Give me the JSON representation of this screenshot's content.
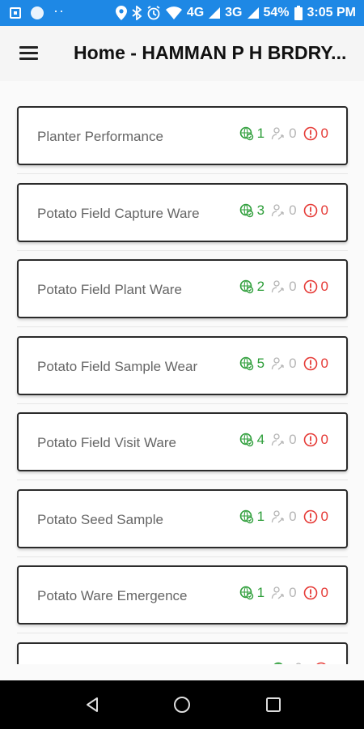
{
  "status_bar": {
    "network": "4G",
    "network2": "3G",
    "battery": "54%",
    "time": "3:05 PM",
    "background": "#1e88e5"
  },
  "header": {
    "title": "Home - HAMMAN P H BRDRY..."
  },
  "icons": {
    "completed": "globe-check-icon",
    "shared": "person-share-icon",
    "errors": "alert-circle-icon"
  },
  "colors": {
    "completed": "#2e9e3a",
    "shared": "#b5b5b5",
    "errors": "#e53935"
  },
  "items": [
    {
      "label": "Planter Performance",
      "completed": "1",
      "shared": "0",
      "errors": "0"
    },
    {
      "label": "Potato Field Capture Ware",
      "completed": "3",
      "shared": "0",
      "errors": "0"
    },
    {
      "label": "Potato Field Plant Ware",
      "completed": "2",
      "shared": "0",
      "errors": "0"
    },
    {
      "label": "Potato Field Sample Wear",
      "completed": "5",
      "shared": "0",
      "errors": "0"
    },
    {
      "label": "Potato Field Visit Ware",
      "completed": "4",
      "shared": "0",
      "errors": "0"
    },
    {
      "label": "Potato Seed Sample",
      "completed": "1",
      "shared": "0",
      "errors": "0"
    },
    {
      "label": "Potato Ware Emergence",
      "completed": "1",
      "shared": "0",
      "errors": "0"
    }
  ]
}
